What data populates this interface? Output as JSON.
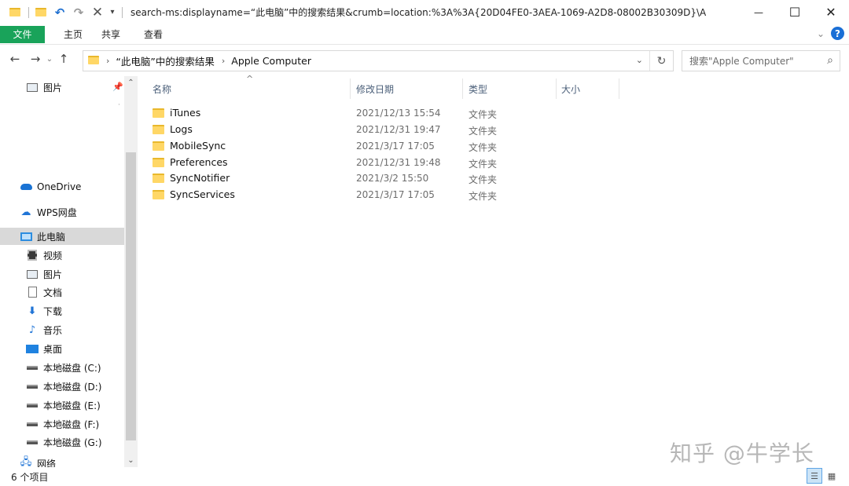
{
  "window": {
    "title": "search-ms:displayname=“此电脑”中的搜索结果&crumb=location:%3A%3A{20D04FE0-3AEA-1069-A2D8-08002B30309D}\\A",
    "controls": {
      "minimize": "—",
      "maximize": "☐",
      "close": "✕"
    }
  },
  "ribbon": {
    "file": "文件",
    "tabs": [
      "主页",
      "共享",
      "查看"
    ]
  },
  "address": {
    "crumbs": [
      "“此电脑”中的搜索结果",
      "Apple Computer"
    ]
  },
  "search": {
    "placeholder": "搜索\"Apple Computer\""
  },
  "sidebar": {
    "quick_item": "图片",
    "onedrive": "OneDrive",
    "wps": "WPS网盘",
    "thispc": "此电脑",
    "items": [
      "视频",
      "图片",
      "文档",
      "下载",
      "音乐",
      "桌面"
    ],
    "drives": [
      "本地磁盘 (C:)",
      "本地磁盘 (D:)",
      "本地磁盘 (E:)",
      "本地磁盘 (F:)",
      "本地磁盘 (G:)"
    ],
    "network": "网络"
  },
  "columns": {
    "name": "名称",
    "date": "修改日期",
    "type": "类型",
    "size": "大小"
  },
  "files": [
    {
      "name": "iTunes",
      "date": "2021/12/13 15:54",
      "type": "文件夹"
    },
    {
      "name": "Logs",
      "date": "2021/12/31 19:47",
      "type": "文件夹"
    },
    {
      "name": "MobileSync",
      "date": "2021/3/17 17:05",
      "type": "文件夹"
    },
    {
      "name": "Preferences",
      "date": "2021/12/31 19:48",
      "type": "文件夹"
    },
    {
      "name": "SyncNotifier",
      "date": "2021/3/2 15:50",
      "type": "文件夹"
    },
    {
      "name": "SyncServices",
      "date": "2021/3/17 17:05",
      "type": "文件夹"
    }
  ],
  "status": {
    "count": "6 个项目"
  },
  "watermark": "知乎 @牛学长"
}
